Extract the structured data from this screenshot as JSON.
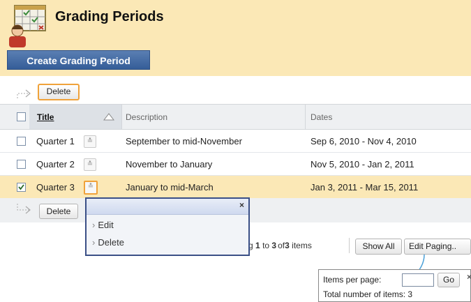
{
  "header": {
    "title": "Grading Periods",
    "create_button": "Create Grading Period"
  },
  "toolbar": {
    "delete_top": "Delete",
    "delete_bottom": "Delete"
  },
  "grid": {
    "columns": {
      "title": "Title",
      "description": "Description",
      "dates": "Dates"
    },
    "rows": [
      {
        "title": "Quarter 1",
        "description": "September to mid-November",
        "dates": "Sep 6, 2010 - Nov 4, 2010",
        "checked": false
      },
      {
        "title": "Quarter 2",
        "description": "November to January",
        "dates": "Nov 5, 2010 - Jan 2, 2011",
        "checked": false
      },
      {
        "title": "Quarter 3",
        "description": "January to mid-March",
        "dates": "Jan 3, 2011 - Mar 15, 2011",
        "checked": true
      }
    ]
  },
  "context_menu": {
    "items": [
      "Edit",
      "Delete"
    ]
  },
  "paging": {
    "displaying_partial": "g",
    "range_start": "1",
    "range_to": "to",
    "range_end": "3",
    "of": "of",
    "total": "3",
    "items_label": "items",
    "show_all": "Show All",
    "edit_paging": "Edit Paging.."
  },
  "paging_popup": {
    "items_per_page_label": "Items per page:",
    "go_button": "Go",
    "total_label": "Total number of items: 3",
    "close": "×"
  },
  "colors": {
    "header_bg": "#fbe8b6",
    "primary_button": "#355d98",
    "focus_outline": "#f0a23a",
    "selected_row": "#fbe8b6"
  }
}
